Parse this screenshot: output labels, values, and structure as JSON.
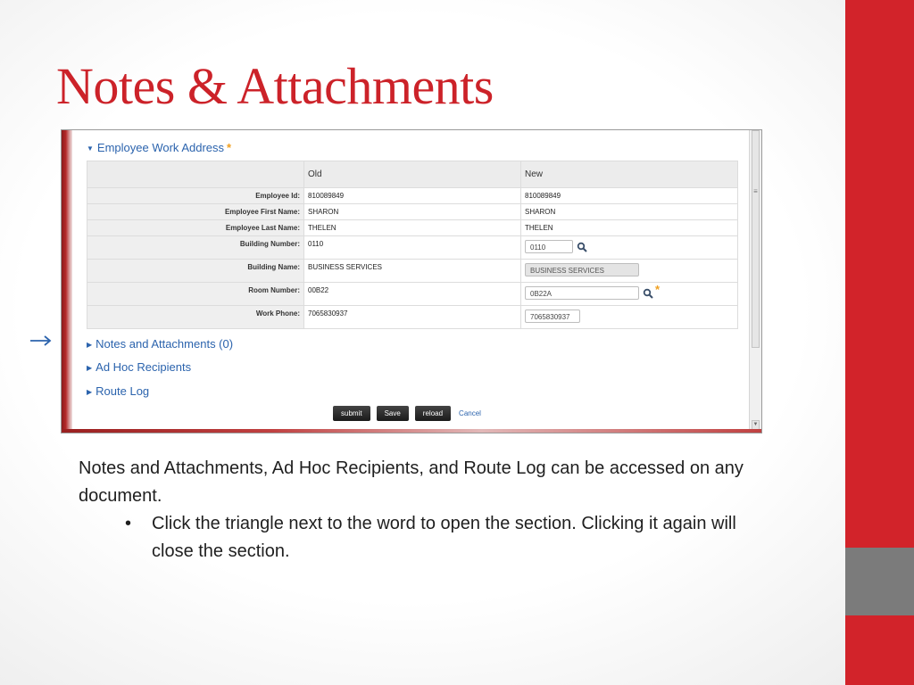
{
  "slide": {
    "title": "Notes & Attachments",
    "body": "Notes and Attachments, Ad Hoc Recipients, and Route Log can be accessed on any document.",
    "bullet": "Click the triangle next to the word to open the section. Clicking it again will close the section.",
    "bullet_marker": "•"
  },
  "form": {
    "section_title": "Employee Work Address",
    "required_marker": "*",
    "columns": {
      "old": "Old",
      "new": "New"
    },
    "rows": [
      {
        "label": "Employee Id:",
        "old": "810089849",
        "new": "810089849"
      },
      {
        "label": "Employee First Name:",
        "old": "SHARON",
        "new": "SHARON"
      },
      {
        "label": "Employee Last Name:",
        "old": "THELEN",
        "new": "THELEN"
      },
      {
        "label": "Building Number:",
        "old": "0110",
        "new": "0110"
      },
      {
        "label": "Building Name:",
        "old": "BUSINESS SERVICES",
        "new": "BUSINESS SERVICES"
      },
      {
        "label": "Room Number:",
        "old": "00B22",
        "new": "0B22A"
      },
      {
        "label": "Work Phone:",
        "old": "7065830937",
        "new": "7065830937"
      }
    ],
    "sections": [
      "Notes and Attachments (0)",
      "Ad Hoc Recipients",
      "Route Log"
    ],
    "buttons": {
      "submit": "submit",
      "save": "Save",
      "reload": "reload",
      "cancel": "Cancel"
    }
  },
  "colors": {
    "title": "#cc2229",
    "accent_red": "#d2232a",
    "accent_gray": "#7b7b7b",
    "link_blue": "#2b63ad",
    "required_orange": "#f0a020"
  },
  "icons": [
    "search-icon",
    "triangle-down-icon",
    "triangle-right-icon",
    "arrow-right-icon",
    "scroll-grip-icon"
  ]
}
